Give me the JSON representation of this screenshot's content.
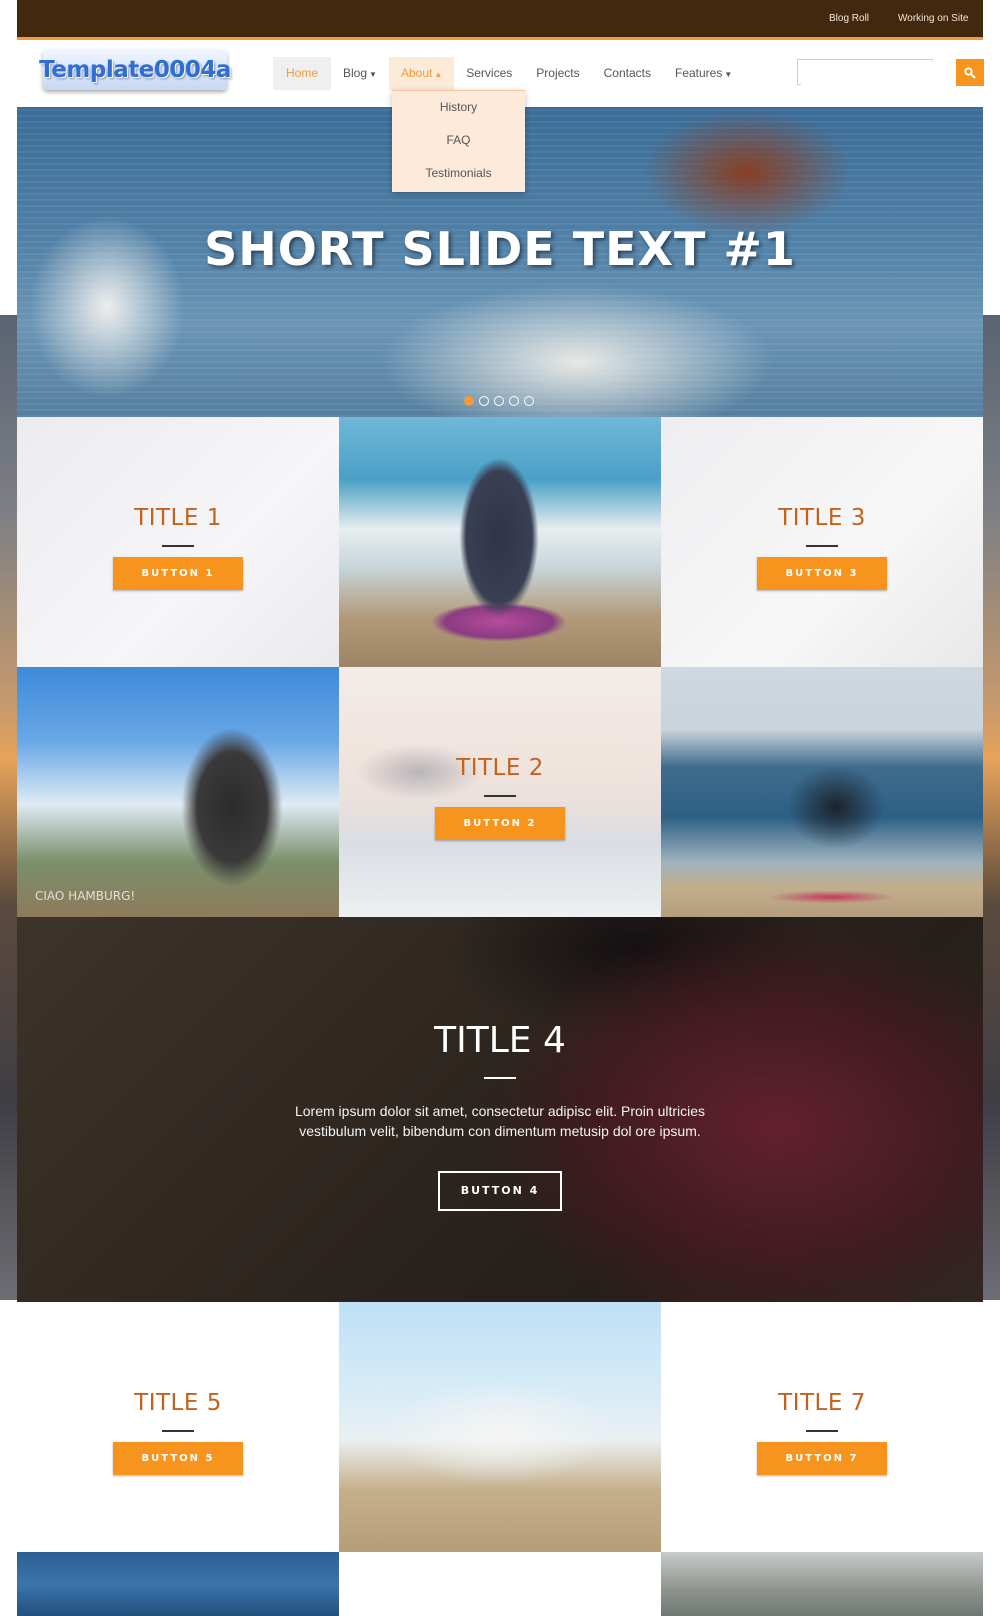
{
  "topbar": {
    "links": [
      "Blog Roll",
      "Working on Site"
    ]
  },
  "logo": {
    "text": "Template0004a"
  },
  "nav": {
    "items": [
      "Home",
      "Blog",
      "About",
      "Services",
      "Projects",
      "Contacts",
      "Features"
    ],
    "about_dropdown": [
      "History",
      "FAQ",
      "Testimonials"
    ]
  },
  "search": {
    "placeholder": ""
  },
  "hero": {
    "slide_text": "SHORT SLIDE TEXT #1",
    "dots_count": 5,
    "active_dot": 1
  },
  "tiles": {
    "t1": {
      "title": "TITLE 1",
      "button": "BUTTON 1"
    },
    "t2": {
      "title": "TITLE 2",
      "button": "BUTTON 2"
    },
    "t3": {
      "title": "TITLE 3",
      "button": "BUTTON 3"
    },
    "t4": {
      "title": "TITLE 4",
      "text_line1": "Lorem ipsum dolor sit amet, consectetur adipisc elit. Proin ultricies",
      "text_line2": "vestibulum velit, bibendum con dimentum metusip dol ore ipsum.",
      "button": "BUTTON 4"
    },
    "t5": {
      "title": "TITLE 5",
      "button": "BUTTON 5"
    },
    "t7": {
      "title": "TITLE 7",
      "button": "BUTTON 7"
    }
  },
  "image_text": {
    "banner": "CIAO HAMBURG!"
  },
  "colors": {
    "accent": "#f7941d",
    "topbar": "#42280f",
    "title": "#c4621b"
  }
}
